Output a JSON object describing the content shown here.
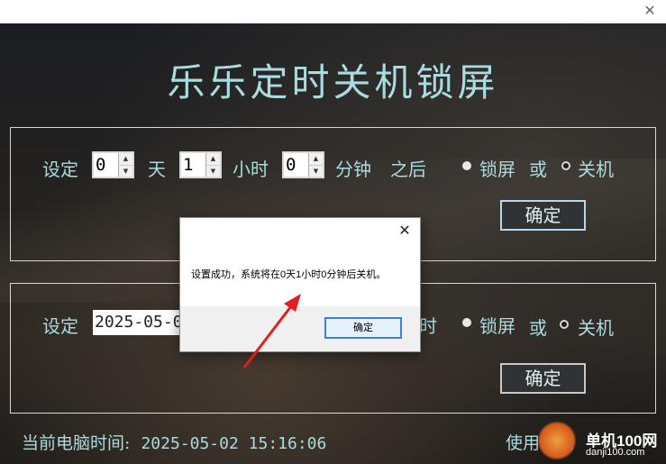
{
  "window": {
    "close_glyph": "✕"
  },
  "app": {
    "title": "乐乐定时关机锁屏"
  },
  "panel1": {
    "prefix": "设定",
    "days_value": "0",
    "days_unit": "天",
    "hours_value": "1",
    "hours_unit": "小时",
    "minutes_value": "0",
    "minutes_unit": "分钟",
    "after_label": "之后",
    "lock_label": "锁屏",
    "or_label": "或",
    "shutdown_label": "关机",
    "confirm_label": "确定"
  },
  "panel2": {
    "prefix": "设定",
    "datetime_value": "2025-05-0",
    "hour_unit_partial": "时",
    "lock_label": "锁屏",
    "or_label": "或",
    "shutdown_label": "关机",
    "confirm_label": "确定"
  },
  "status": {
    "current_time_label": "当前电脑时间:",
    "current_time_value": "2025-05-02  15:16:06"
  },
  "help": {
    "label": "使用说明"
  },
  "watermark": {
    "site_name": "单机100网",
    "site_url": "danji100.com"
  },
  "dialog": {
    "close_glyph": "✕",
    "message": "设置成功，系统将在0天1小时0分钟后关机。",
    "ok_label": "确定"
  },
  "colors": {
    "accent_text": "#a9dbe0",
    "annotation_arrow": "#e02020",
    "dialog_ok_border": "#3c7fd6"
  }
}
